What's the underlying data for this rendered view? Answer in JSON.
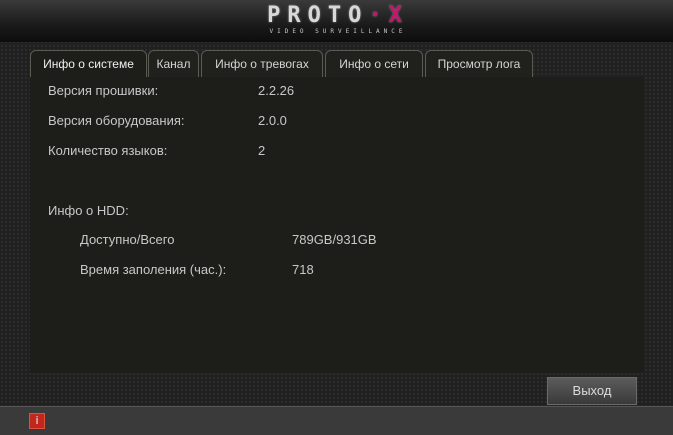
{
  "logo": {
    "brand_main": "PROTO",
    "brand_x": "·X",
    "tagline": "VIDEO SURVEILLANCE"
  },
  "tabs": [
    {
      "label": "Инфо о системе",
      "active": true
    },
    {
      "label": "Канал",
      "active": false
    },
    {
      "label": "Инфо о тревогах",
      "active": false
    },
    {
      "label": "Инфо о сети",
      "active": false
    },
    {
      "label": "Просмотр лога",
      "active": false
    }
  ],
  "system": {
    "firmware_label": "Версия прошивки:",
    "firmware_value": "2.2.26",
    "hardware_label": "Версия оборудования:",
    "hardware_value": "2.0.0",
    "languages_label": "Количество языков:",
    "languages_value": "2"
  },
  "hdd": {
    "section_label": "Инфо о HDD:",
    "capacity_label": "Доступно/Всего",
    "capacity_value": "789GB/931GB",
    "fill_time_label": "Время заполения (час.):",
    "fill_time_value": "718"
  },
  "actions": {
    "exit_label": "Выход"
  },
  "footer": {
    "info_icon_glyph": "i"
  },
  "colors": {
    "accent_magenta": "#c4166e",
    "alert_red": "#c0281e"
  }
}
